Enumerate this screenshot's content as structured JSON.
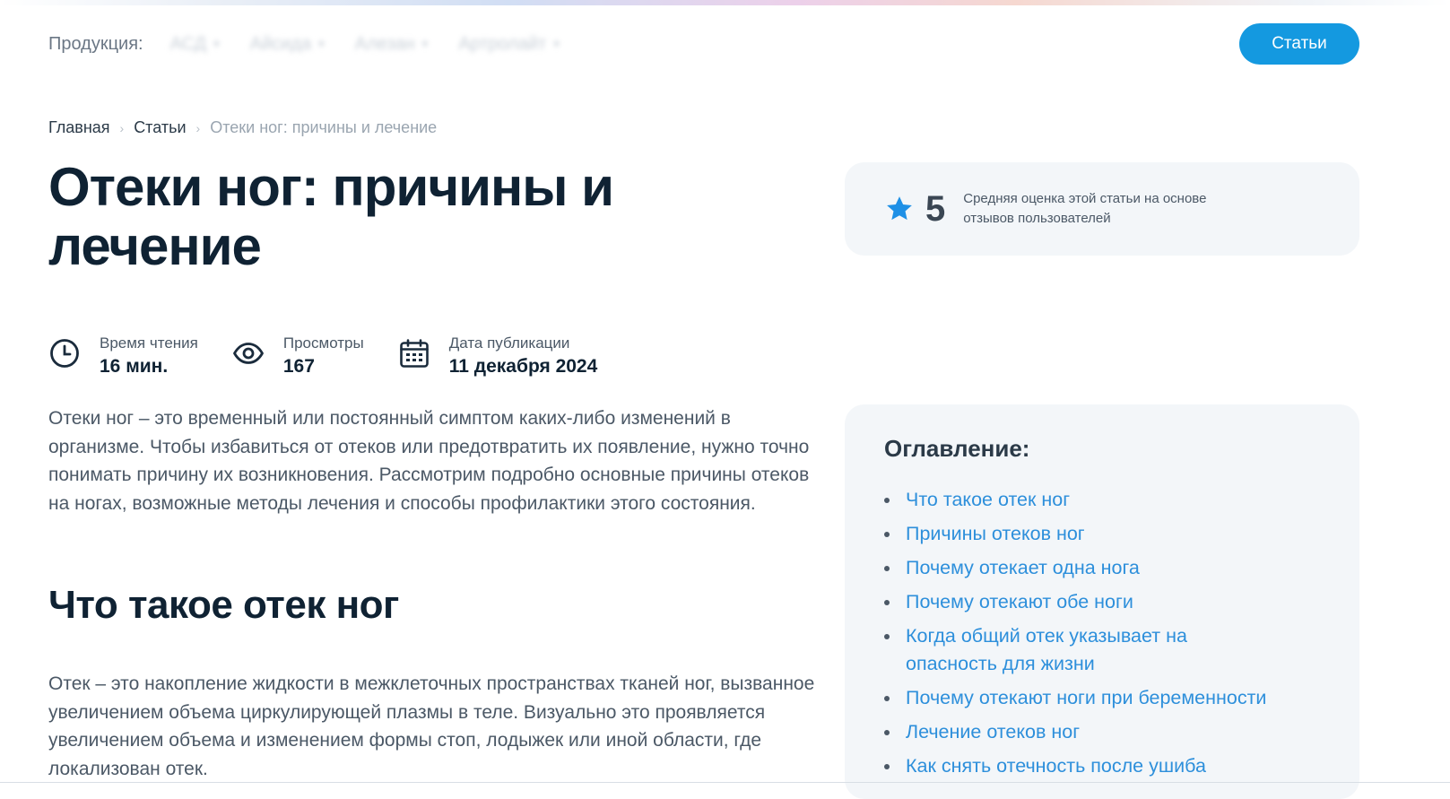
{
  "header": {
    "products_label": "Продукция:",
    "nav": [
      {
        "label": "АСД"
      },
      {
        "label": "Айсида"
      },
      {
        "label": "Алезан"
      },
      {
        "label": "Артролайт"
      }
    ],
    "articles_button": "Статьи"
  },
  "breadcrumb": {
    "home": "Главная",
    "articles": "Статьи",
    "current": "Отеки ног: причины и лечение"
  },
  "article": {
    "title": "Отеки ног: причины и лечение",
    "meta": {
      "reading_label": "Время чтения",
      "reading_value": "16 мин.",
      "views_label": "Просмотры",
      "views_value": "167",
      "date_label": "Дата публикации",
      "date_value": "11 декабря 2024"
    },
    "intro": "Отеки ног – это временный или постоянный симптом каких-либо изменений в организме. Чтобы избавиться от отеков или предотвратить их появление, нужно точно понимать причину их возникновения. Рассмотрим подробно основные причины отеков на ногах, возможные методы лечения и способы профилактики этого состояния.",
    "section1_title": "Что такое отек ног",
    "section1_text": "Отек – это накопление жидкости в межклеточных пространствах тканей ног, вызванное увеличением объема циркулирующей плазмы в теле. Визуально это проявляется увеличением объема и изменением формы стоп, лодыжек или иной области, где локализован отек."
  },
  "rating": {
    "value": "5",
    "text": "Средняя оценка этой статьи на основе отзывов пользователей"
  },
  "toc": {
    "title": "Оглавление:",
    "items": [
      "Что такое отек ног",
      "Причины отеков ног",
      "Почему отекает одна нога",
      "Почему отекают обе ноги",
      "Когда общий отек указывает на опасность для жизни",
      "Почему отекают ноги при беременности",
      "Лечение отеков ног",
      "Как снять отечность после ушиба"
    ]
  },
  "colors": {
    "accent": "#1499e0",
    "link": "#2d8fdb",
    "heading": "#0f2233",
    "card_bg": "#f3f6f9"
  },
  "icons": {
    "reading": "clock-icon",
    "views": "eye-icon",
    "date": "calendar-icon",
    "rating": "star-icon"
  }
}
